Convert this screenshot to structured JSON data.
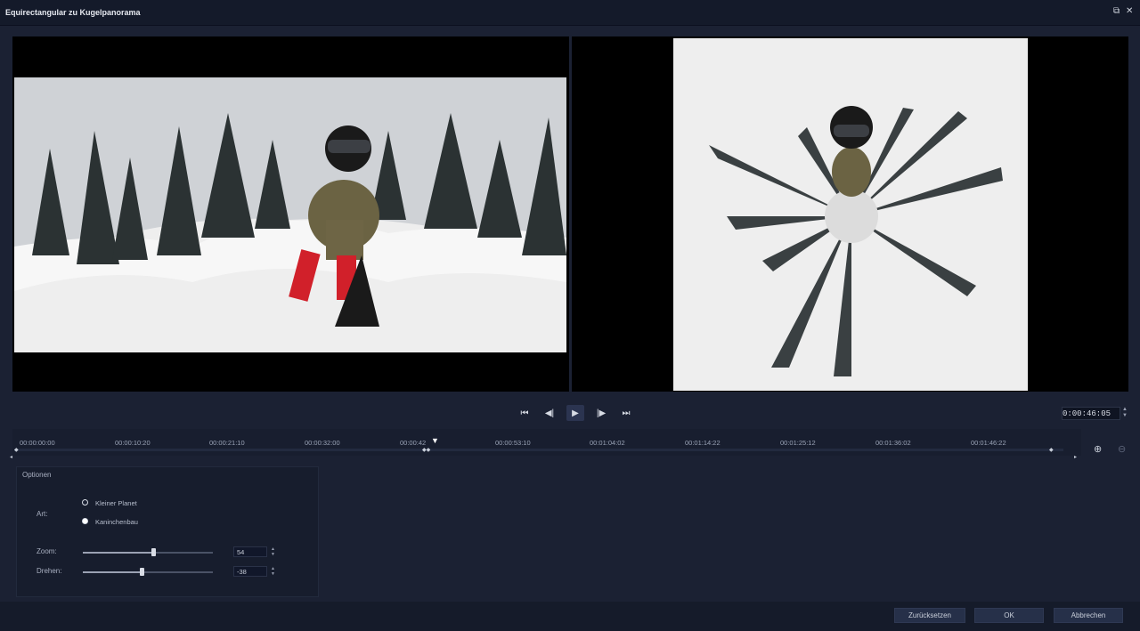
{
  "window": {
    "title": "Equirectangular zu Kugelpanorama",
    "restore_icon": "restore-icon",
    "close_icon": "close-icon"
  },
  "player": {
    "timecode": "0:00:46:05",
    "buttons": [
      "go-to-start-icon",
      "previous-frame-icon",
      "play-icon",
      "next-frame-icon",
      "go-to-end-icon"
    ]
  },
  "timeline": {
    "ticks": [
      "00:00:00:00",
      "00:00:10:20",
      "00:00:21:10",
      "00:00:32:00",
      "00:00:42",
      "00:00:53:10",
      "00:01:04:02",
      "00:01:14:22",
      "00:01:25:12",
      "00:01:36:02",
      "00:01:46:22"
    ]
  },
  "options": {
    "title": "Optionen",
    "art_label": "Art:",
    "art_options": [
      "Kleiner Planet",
      "Kaninchenbau"
    ],
    "art_selected": "Kaninchenbau",
    "zoom_label": "Zoom:",
    "zoom_value": "54",
    "zoom_level": 0.54,
    "rotate_label": "Drehen:",
    "rotate_value": "-38",
    "rotate_level": 0.45
  },
  "footer": {
    "reset_label": "Zurücksetzen",
    "ok_label": "OK",
    "cancel_label": "Abbrechen"
  }
}
